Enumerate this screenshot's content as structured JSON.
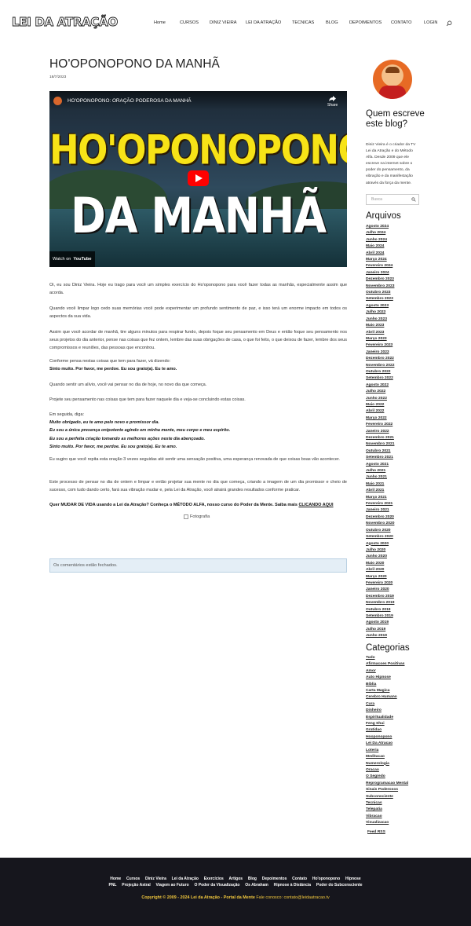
{
  "header": {
    "logo": "LEI DA ATRAÇÃO",
    "nav": [
      "Home",
      "CURSOS",
      "DINIZ VIEIRA",
      "LEI DA ATRAÇÃO",
      "TECNICAS",
      "BLOG",
      "DEPOIMENTOS",
      "CONTATO",
      "LOGIN"
    ],
    "search_icon": "search-icon"
  },
  "post": {
    "title": "HO'OPONOPONO DA MANHÃ",
    "date": "18/7/2023",
    "video": {
      "title": "HO'OPONOPONO: ORAÇÃO PODEROSA DA MANHÃ",
      "share": "Share",
      "line1": "HO'OPONOPONO",
      "line2": "DA MANHÃ",
      "watch_on": "Watch on",
      "youtube": "YouTube"
    },
    "p1": "Oi, eu sou Diniz Vieira. Hoje eu trago para você um simples exercício do Ho'oponopono para você fazer todas as manhãs, especialmente assim que acorda.",
    "p2": "Quando você limpar logo cedo suas memórias você pode experimentar um profundo sentimento de paz, e isso terá um enorme impacto em todos os aspectos da sua vida.",
    "p3": "Assim que você acordar de manhã, tire alguns minutos para respirar fundo, depois foque seu pensamento em Deus e então foque seu pensamento nos seus projetos do dia anterior, pense nas coisas que fez ontem, lembre das suas obrigações de casa, o que foi feito, o que deixou de fazer, lembre dos seus compromissos e reuniões, das pessoas que encontrou.",
    "p4a": "Conforme pensa nestas coisas que tem para fazer, vá dizendo:",
    "p4b": "Sinto muito. Por favor, me perdoe. Eu sou grato(a). Eu te amo.",
    "p5": "Quando sentir um alívio, você vai pensar no dia de hoje, no novo dia que começa.",
    "p6": "Projete seu pensamento nas coisas que tem para fazer naquele dia e veja-se concluindo estas coisas.",
    "p7a": "Em seguida, diga:",
    "p7b": "Muito obrigado, eu te amo pelo novo e promissor dia.",
    "p7c": "Eu sou a única presença onipotente agindo em minha mente, meu corpo e meu espírito.",
    "p7d": "Eu sou a perfeita criação tomando as melhores ações neste dia abençoado.",
    "p7e": "Sinto muito. Por favor, me perdoe. Eu sou grato(a). Eu te amo.",
    "p8": "Eu sugiro que você repita esta oração 3 vezes seguidas até sentir uma sensação positiva, uma esperança renovada de que coisas boas vão acontecer.",
    "p9": "Este processo de pensar no dia de ontem e limpar e então projetar sua mente no dia que começa, criando a imagem de um dia promissor e cheio de sucesso, com tudo dando certo, fará sua vibração mudar e, pela Lei da Atração, você atrairá grandes resultados conforme praticar.",
    "cta": "Quer MUDAR DE VIDA usando a Lei da Atração? Conheça o MÉTODO ALFA, nosso curso do Poder da Mente. Saiba mais",
    "cta_link": "CLICANDO AQUI",
    "photo_alt": "Fotografia",
    "comments_closed": "Os comentários estão fechados."
  },
  "sidebar": {
    "about_title": "Quem escreve este blog?",
    "about_text": "Diniz Vieira é o criador da TV Lei da Atração e do Método Alfa. Desde 2009 que ele escreve na internet sobre o poder do pensamento, da vibração e da manifestação através da força da mente.",
    "search_placeholder": "Busca",
    "archives_title": "Arquivos",
    "archives": [
      "Agosto 2024",
      "Julho 2024",
      "Junho 2024",
      "Maio 2024",
      "Abril 2024",
      "Março 2024",
      "Fevereiro 2024",
      "Janeiro 2024",
      "Dezembro 2023",
      "Novembro 2023",
      "Outubro 2023",
      "Setembro 2023",
      "Agosto 2023",
      "Julho 2023",
      "Junho 2023",
      "Maio 2023",
      "Abril 2023",
      "Março 2023",
      "Fevereiro 2023",
      "Janeiro 2023",
      "Dezembro 2022",
      "Novembro 2022",
      "Outubro 2022",
      "Setembro 2022",
      "Agosto 2022",
      "Julho 2022",
      "Junho 2022",
      "Maio 2022",
      "Abril 2022",
      "Março 2022",
      "Fevereiro 2022",
      "Janeiro 2022",
      "Dezembro 2021",
      "Novembro 2021",
      "Outubro 2021",
      "Setembro 2021",
      "Agosto 2021",
      "Julho 2021",
      "Junho 2021",
      "Maio 2021",
      "Abril 2021",
      "Março 2021",
      "Fevereiro 2021",
      "Janeiro 2021",
      "Dezembro 2020",
      "Novembro 2020",
      "Outubro 2020",
      "Setembro 2020",
      "Agosto 2020",
      "Julho 2020",
      "Junho 2020",
      "Maio 2020",
      "Abril 2020",
      "Março 2020",
      "Fevereiro 2020",
      "Janeiro 2020",
      "Dezembro 2019",
      "Novembro 2019",
      "Outubro 2019",
      "Setembro 2019",
      "Agosto 2019",
      "Julho 2019",
      "Junho 2019"
    ],
    "categories_title": "Categorias",
    "categories": [
      "Tudo",
      "Afirmacoes Positivas",
      "Amor",
      "Auto Hipnose",
      "Bíblia",
      "Carta Magica",
      "Cerebro Humano",
      "Cura",
      "Dinheiro",
      "Espiritualidade",
      "Feng Shui",
      "Gratidao",
      "Hooponopono",
      "Lei Da Atracao",
      "Loteria",
      "Meditacao",
      "Numerologia",
      "Oracao",
      "O Segredo",
      "Reprogramacao Mental",
      "Sinais Poderosos",
      "Subconsciente",
      "Tecnicas",
      "Telepatia",
      "Vibracao",
      "Visualizacao"
    ],
    "feed": "Feed RSS"
  },
  "footer": {
    "row1": [
      "Home",
      "Cursos",
      "Diniz Vieira",
      "Lei da Atração",
      "Exercícios",
      "Artigos",
      "Blog",
      "Depoimentos",
      "Contato",
      "Ho'oponopono",
      "Hipnose"
    ],
    "row2": [
      "PNL",
      "Projeção Astral",
      "Viagem ao Futuro",
      "O Poder da Visualização",
      "Os Abraham",
      "Hipnose à Distância",
      "Poder do Subconsciente"
    ],
    "copyright": "Copyright © 2009 - 2024 Lei da Atração - Portal da Mente",
    "contact": " Fale conosco: contato@leidaatracao.tv"
  }
}
